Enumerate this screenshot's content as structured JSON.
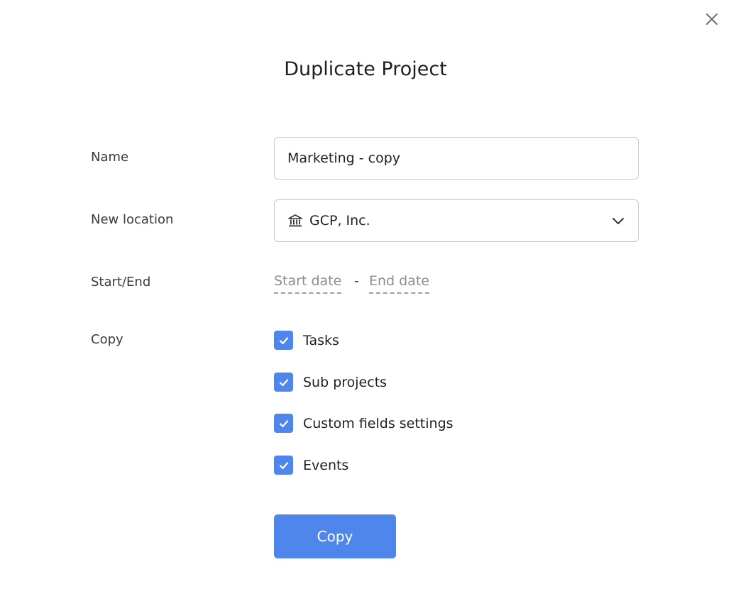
{
  "dialog": {
    "title": "Duplicate Project"
  },
  "form": {
    "name": {
      "label": "Name",
      "value": "Marketing - copy"
    },
    "location": {
      "label": "New location",
      "value": "GCP, Inc.",
      "icon": "building-icon"
    },
    "dates": {
      "label": "Start/End",
      "start_placeholder": "Start date",
      "separator": "-",
      "end_placeholder": "End date"
    },
    "copy": {
      "label": "Copy",
      "options": [
        {
          "label": "Tasks",
          "checked": true
        },
        {
          "label": "Sub projects",
          "checked": true
        },
        {
          "label": "Custom fields settings",
          "checked": true
        },
        {
          "label": "Events",
          "checked": true
        }
      ]
    }
  },
  "actions": {
    "copy_label": "Copy"
  },
  "colors": {
    "accent": "#4f86ec",
    "border": "#c6c9ce",
    "muted_text": "#8a8f96"
  }
}
